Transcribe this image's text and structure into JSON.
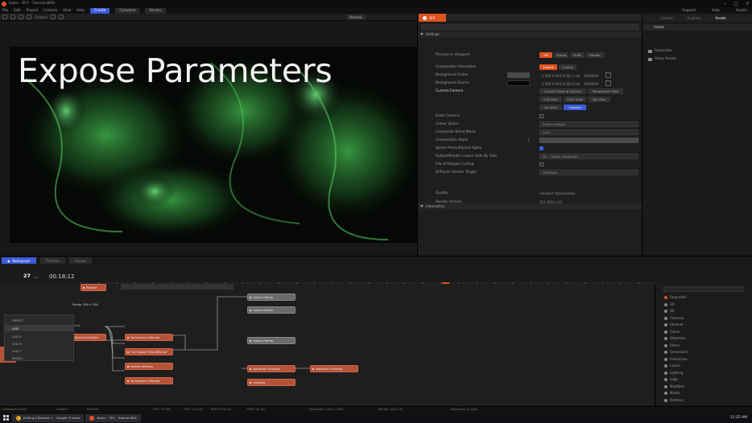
{
  "window": {
    "title": "Gaea - SFX - Tutorial.BRD"
  },
  "menubar": {
    "items": [
      "File",
      "Edit",
      "Project",
      "Camera",
      "View",
      "Help"
    ],
    "tabs": [
      {
        "label": "Create",
        "active": true
      },
      {
        "label": "Compose",
        "active": false
      },
      {
        "label": "Render",
        "active": false
      }
    ],
    "right": [
      "Support",
      "Help",
      "Assets"
    ]
  },
  "toolbar": {
    "preview_label": "Preview",
    "camera_label": "Camera"
  },
  "overlay_title": "Expose Parameters",
  "properties": {
    "tab_label": "SFX",
    "section_settings": "Settings",
    "rows": [
      {
        "label": "Preview in Viewport",
        "type": "buttons",
        "options": [
          "Off",
          "Debug",
          "Draft",
          "Render"
        ],
        "active": 0
      },
      {
        "label": "Composition Resolution",
        "type": "buttons",
        "options": [
          "Project",
          "Custom"
        ],
        "active": 0
      },
      {
        "label": "Background Colour",
        "type": "color",
        "value": "0.000 0.000 0.000 1.00",
        "hex": "#000000"
      },
      {
        "label": "Background Source",
        "type": "color",
        "value": "0.000 0.000 0.000 0.00",
        "hex": "#000000"
      },
      {
        "label": "Current Camera",
        "type": "buttons2",
        "options": [
          "Current Viewing Camera",
          "Perspective View",
          "Left View",
          "Front View",
          "Top View",
          "Iso View",
          "Camera"
        ],
        "active": 6
      },
      {
        "label": "Enter Camera",
        "type": "check",
        "value": false
      },
      {
        "label": "Colour Space",
        "type": "dropdown",
        "value": "Project Default"
      },
      {
        "label": "Composite Blend Mode",
        "type": "dropdown",
        "value": "Over"
      },
      {
        "label": "Composition Alpha",
        "type": "slider",
        "value": "1"
      },
      {
        "label": "Ignore Premultiplied Alpha",
        "type": "check",
        "value": true
      },
      {
        "label": "Output/Render Layers Gets By Side",
        "type": "dropdown",
        "value": "No - Classic Composite"
      },
      {
        "label": "Pile of Polygon Culling",
        "type": "check",
        "value": false
      },
      {
        "label": "Diffusion Render Target",
        "type": "dropdown",
        "value": "sDiffusion"
      }
    ],
    "section_info": "Information",
    "info_rows": [
      {
        "label": "Quality",
        "value": "Viewport Optimisation"
      },
      {
        "label": "Render Version",
        "value": "SFX 2023 v10"
      }
    ]
  },
  "assets": {
    "tabs": [
      "Console",
      "Explorer",
      "Assets"
    ],
    "active_tab": 2,
    "header": "Assets",
    "items": [
      "Favourites",
      "Show Assets"
    ]
  },
  "bottom": {
    "tabs": [
      {
        "label": "Nodegraph",
        "active": true
      },
      {
        "label": "Timeline",
        "active": false
      },
      {
        "label": "Curves",
        "active": false
      }
    ],
    "frame": "27",
    "frame_unit": "fps",
    "timecode": "00:18:12",
    "ruler_marks": [
      "0",
      "50",
      "100",
      "150",
      "200",
      "250",
      "300",
      "350",
      "400",
      "450",
      "500",
      "550",
      "600",
      "650",
      "700",
      "750",
      "800",
      "850",
      "900",
      "950",
      "1000",
      "1050",
      "1100",
      "1150",
      "1200",
      "1250",
      "1300",
      "1350",
      "1400",
      "1450",
      "1500",
      "1550"
    ],
    "playhead_frame": "1320",
    "lod_menu": {
      "items": [
        "DIRECT",
        "LOD",
        "LOD A",
        "LOD B",
        "LOD C",
        "MODEL"
      ],
      "selected": 1
    },
    "nodes": [
      {
        "label": "Render",
        "color": "orange",
        "id": "n1"
      },
      {
        "label": "Particle Emitter",
        "color": "orange",
        "id": "n2"
      },
      {
        "label": "Turbulence Affector",
        "color": "orange",
        "id": "n3"
      },
      {
        "label": "Curl Noise Field Affector",
        "color": "orange",
        "id": "n4"
      },
      {
        "label": "Vortex Affector",
        "color": "orange",
        "id": "n5"
      },
      {
        "label": "Turbulence Affector",
        "color": "orange",
        "id": "n6"
      },
      {
        "label": "Output Ramp",
        "color": "gray",
        "id": "n7"
      },
      {
        "label": "Output Buffer",
        "color": "gray",
        "id": "n8"
      },
      {
        "label": "Output Ramp",
        "color": "gray",
        "id": "n9"
      },
      {
        "label": "Attribute Shading",
        "color": "orange",
        "id": "n10"
      },
      {
        "label": "Attribute Shading",
        "color": "orange",
        "id": "n11"
      },
      {
        "label": "Lighting",
        "color": "orange",
        "id": "n12"
      },
      {
        "label": "Points 256 x 256",
        "color": "text",
        "id": "n13"
      }
    ],
    "outliner": {
      "items": [
        "Favourites",
        "2D",
        "3D",
        "Cameras",
        "Channel",
        "Colour",
        "Distortion",
        "Filters",
        "Generators",
        "Interactive",
        "Layers",
        "Lighting",
        "Logic",
        "Modifiers",
        "Masks",
        "Particles"
      ]
    }
  },
  "status": {
    "items": [
      "Composed Errors",
      "Camera",
      "Particles",
      "GPU: 33 Bits",
      "CPU: 24.0 ms",
      "RAM: 3700 ms",
      "VRAM: 81 ms",
      "Resolution: 1920 x 1080",
      "Render: 00:02:34",
      "Sequence: 1x Cam"
    ]
  },
  "taskbar": {
    "tasks": [
      {
        "label": "Editing a Release + - Google Chrome",
        "color": "#e0a020"
      },
      {
        "label": "Notch - SFX - Tutorial.BRD",
        "color": "#e0521e"
      }
    ],
    "clock": "12:25 AM"
  }
}
